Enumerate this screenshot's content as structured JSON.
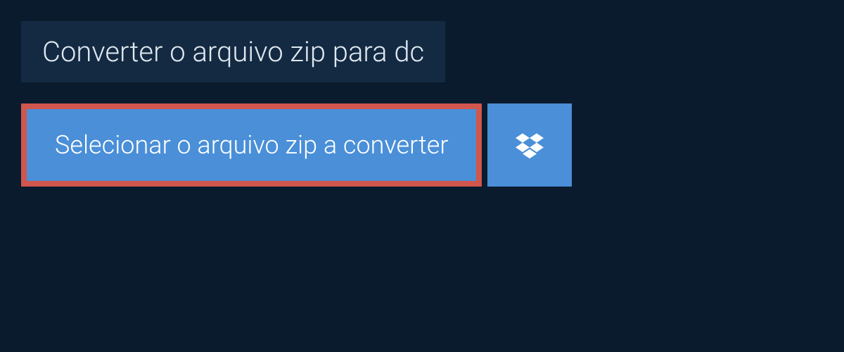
{
  "header": {
    "title": "Converter o arquivo zip para dc"
  },
  "actions": {
    "select_file_label": "Selecionar o arquivo zip a converter",
    "dropbox_icon": "dropbox"
  }
}
